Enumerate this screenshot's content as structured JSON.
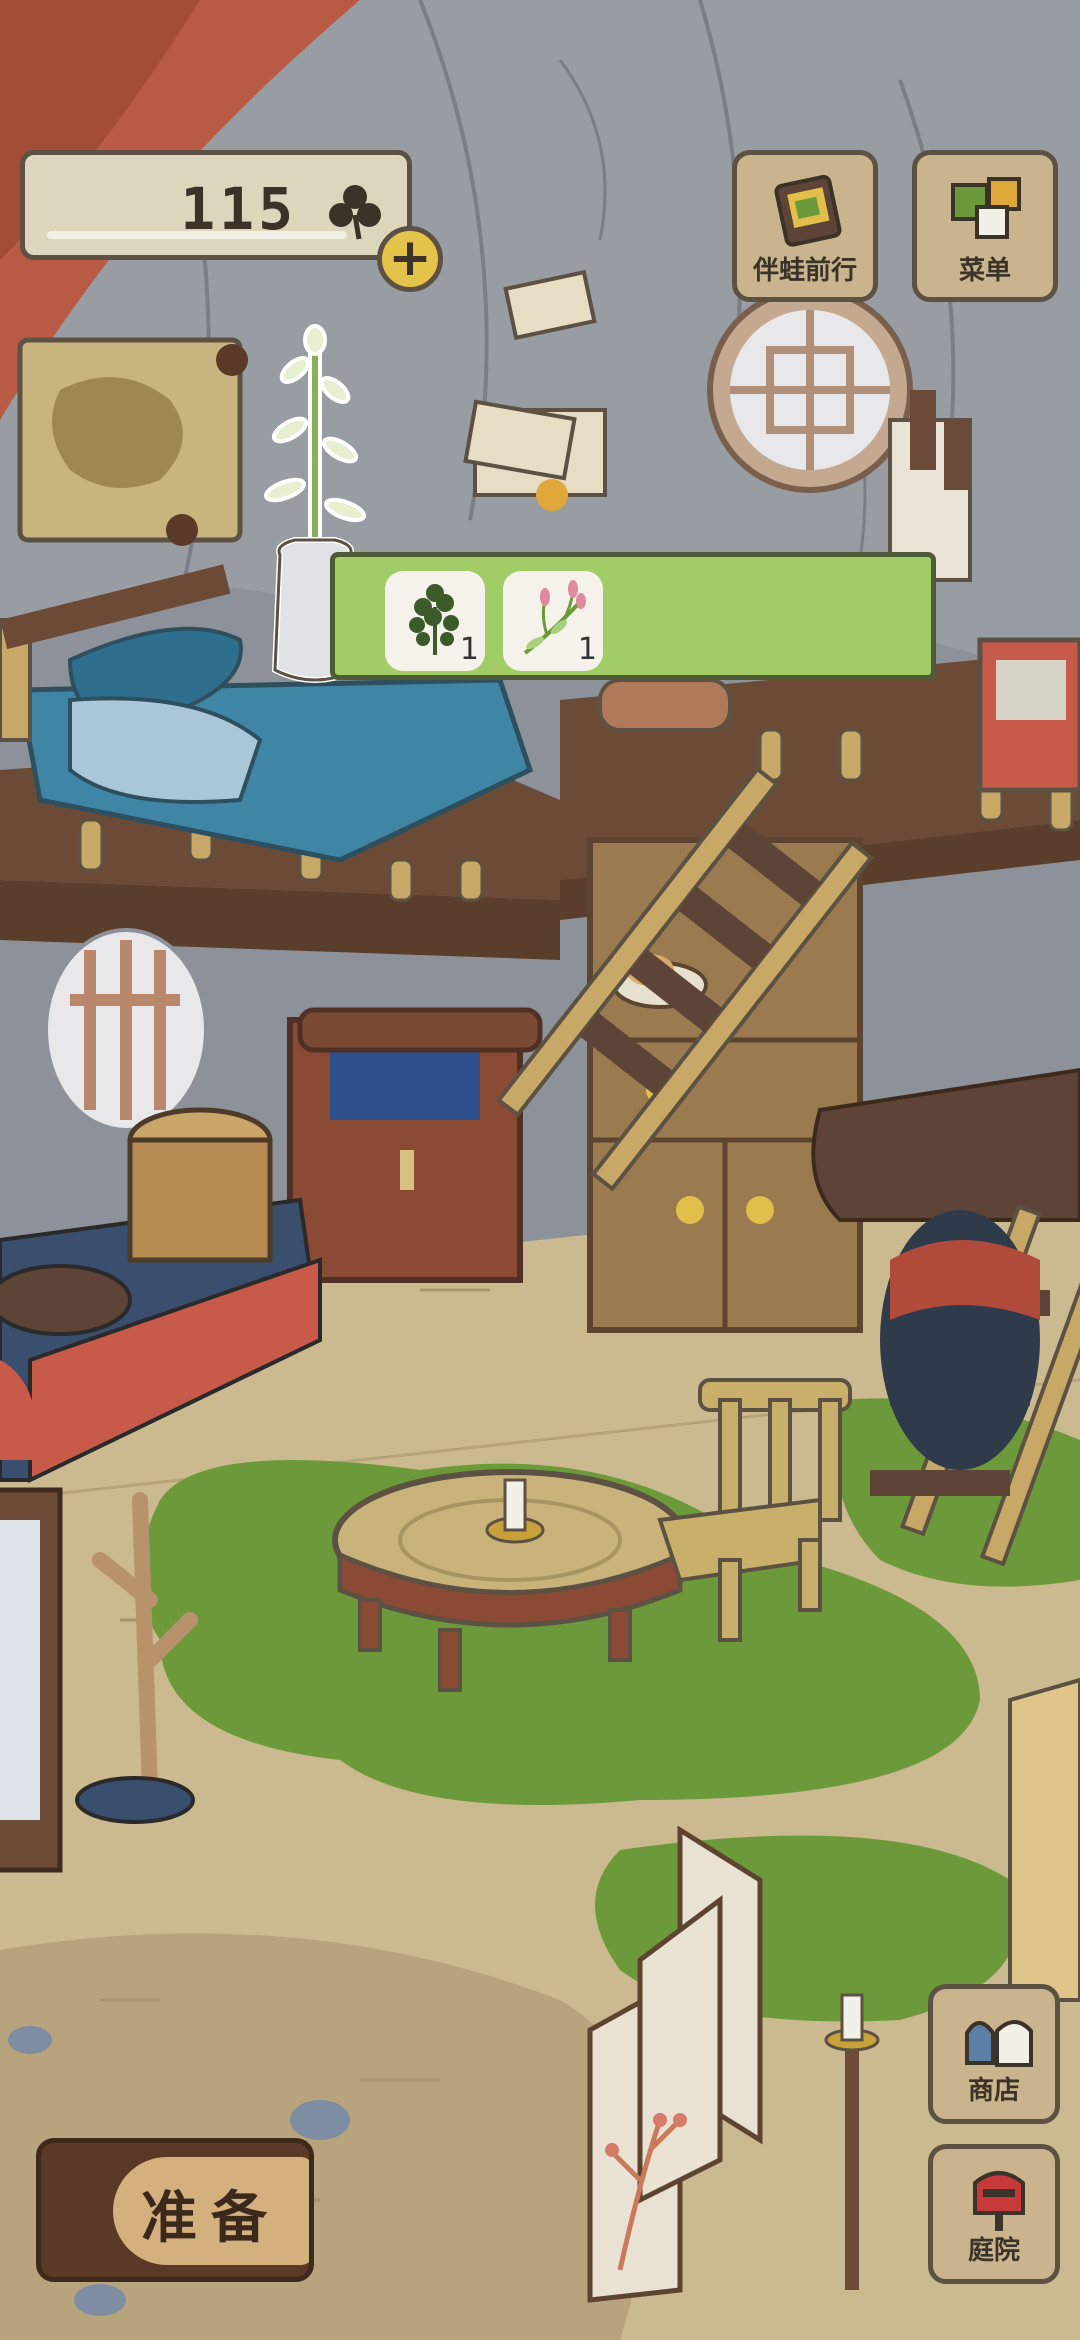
{
  "hud": {
    "clover_count": "115",
    "plus_icon": "plus-icon",
    "clover_icon": "clover-icon"
  },
  "top_buttons": [
    {
      "label": "伴蛙前行",
      "icon": "journal-icon"
    },
    {
      "label": "菜单",
      "icon": "menu-cards-icon"
    }
  ],
  "side_buttons": [
    {
      "label": "商店",
      "icon": "shop-bags-icon"
    },
    {
      "label": "庭院",
      "icon": "mailbox-icon"
    }
  ],
  "prepare_button": {
    "label": "准备"
  },
  "item_bar": {
    "slots": [
      {
        "count": "1",
        "icon": "clover-bundle-icon"
      },
      {
        "count": "1",
        "icon": "flower-sprig-icon"
      }
    ]
  },
  "colors": {
    "accent_green": "#a1cc66",
    "button_tan": "#c9b48d",
    "outline": "#5c5142"
  }
}
